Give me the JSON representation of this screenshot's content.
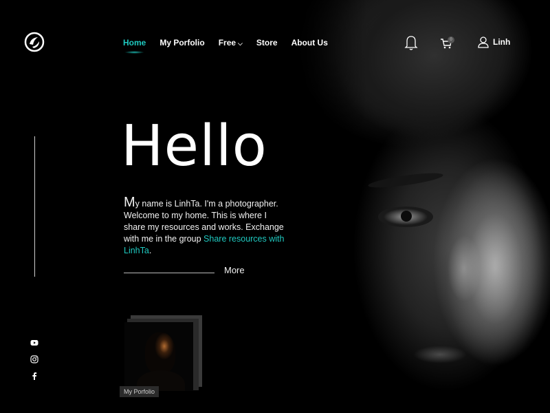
{
  "header": {
    "nav": [
      {
        "label": "Home",
        "active": true
      },
      {
        "label": "My Porfolio",
        "active": false
      },
      {
        "label": "Free",
        "active": false,
        "has_dropdown": true
      },
      {
        "label": "Store",
        "active": false
      },
      {
        "label": "About Us",
        "active": false
      }
    ],
    "cart_count": "0",
    "user_name": "Linh",
    "icons": [
      "logo-icon",
      "bell-icon",
      "cart-icon",
      "user-icon"
    ]
  },
  "hero": {
    "title": "Hello",
    "intro_initial": "M",
    "intro_text": "y name is LinhTa. I'm a photographer. Welcome to my home. This is where I share my resources and works. Exchange with me in the group ",
    "intro_link": "Share resources with LinhTa",
    "intro_end": ".",
    "more_label": "More"
  },
  "portfolio_card": {
    "label": "My Porfolio"
  },
  "social": [
    "youtube-icon",
    "instagram-icon",
    "facebook-icon"
  ],
  "colors": {
    "accent": "#1fc9c0",
    "background": "#000000",
    "text": "#ffffff"
  }
}
